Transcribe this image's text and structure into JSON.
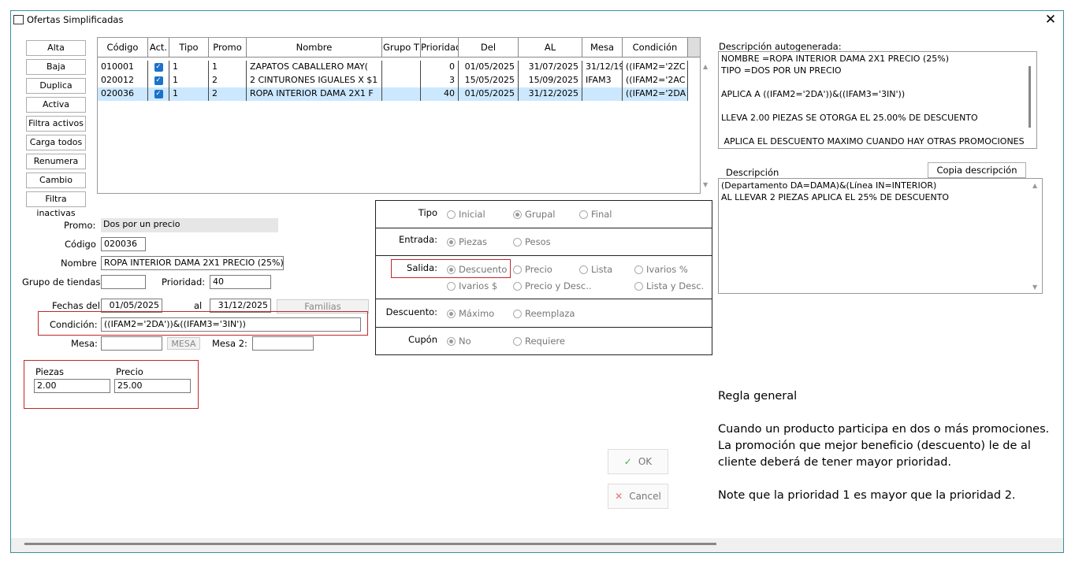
{
  "window": {
    "title": "Ofertas Simplificadas"
  },
  "buttons": [
    "Alta",
    "Baja",
    "Duplica",
    "Activa",
    "Filtra activos",
    "Carga todos",
    "Renumera",
    "Cambio",
    "Filtra inactivas"
  ],
  "grid": {
    "columns": [
      "Código",
      "Act.",
      "Tipo",
      "Promo",
      "Nombre",
      "Grupo T",
      "Prioridad",
      "Del",
      "AL",
      "Mesa",
      "Condición"
    ],
    "rows": [
      {
        "codigo": "010001",
        "tipo": "1",
        "promo": "1",
        "nombre": "ZAPATOS CABALLERO MAY(",
        "grupo": "",
        "prioridad": "0",
        "del": "01/05/2025",
        "al": "31/07/2025",
        "mesa": "31/12/19",
        "condicion": "((IFAM2='2ZC"
      },
      {
        "codigo": "020012",
        "tipo": "1",
        "promo": "2",
        "nombre": "2 CINTURONES IGUALES X $1",
        "grupo": "",
        "prioridad": "3",
        "del": "15/05/2025",
        "al": "15/09/2025",
        "mesa": "IFAM3",
        "condicion": "((IFAM2='2AC"
      },
      {
        "codigo": "020036",
        "tipo": "1",
        "promo": "2",
        "nombre": "ROPA INTERIOR DAMA 2X1 F",
        "grupo": "",
        "prioridad": "40",
        "del": "01/05/2025",
        "al": "31/12/2025",
        "mesa": "",
        "condicion": "((IFAM2='2DA"
      }
    ]
  },
  "form": {
    "promo_label": "Promo:",
    "promo_value": "Dos por un precio",
    "codigo_label": "Código",
    "codigo_value": "020036",
    "nombre_label": "Nombre",
    "nombre_value": "ROPA INTERIOR DAMA 2X1 PRECIO (25%)",
    "grupo_label": "Grupo de tiendas:",
    "grupo_value": "",
    "prioridad_label": "Prioridad:",
    "prioridad_value": "40",
    "fechas_label": "Fechas del",
    "fecha_del": "01/05/2025",
    "al_label": "al",
    "fecha_al": "31/12/2025",
    "familias_label": "Familias",
    "condicion_label": "Condición:",
    "condicion_value": "((IFAM2='2DA'))&((IFAM3='3IN'))",
    "mesa_label": "Mesa:",
    "mesa_value": "",
    "mesa_btn": "MESA",
    "mesa2_label": "Mesa 2:",
    "mesa2_value": "",
    "piezas_label": "Piezas",
    "piezas_value": "2.00",
    "precio_label": "Precio",
    "precio_value": "25.00"
  },
  "options": {
    "tipo_label": "Tipo",
    "tipo": [
      "Inicial",
      "Grupal",
      "Final"
    ],
    "entrada_label": "Entrada:",
    "entrada": [
      "Piezas",
      "Pesos"
    ],
    "salida_label": "Salida:",
    "salida": [
      "Descuento",
      "Precio",
      "Lista",
      "Ivarios %",
      "Ivarios $",
      "Precio y Desc..",
      "Lista y Desc."
    ],
    "descuento_label": "Descuento:",
    "descuento": [
      "Máximo",
      "Reemplaza"
    ],
    "cupon_label": "Cupón",
    "cupon": [
      "No",
      "Requiere"
    ]
  },
  "autodesc": {
    "label": "Descripción autogenerada:",
    "text": "NOMBRE =ROPA INTERIOR DAMA 2X1 PRECIO (25%)\nTIPO =DOS POR UN PRECIO\n\nAPLICA A ((IFAM2='2DA'))&((IFAM3='3IN'))\n\nLLEVA 2.00 PIEZAS SE OTORGA EL 25.00% DE DESCUENTO\n\n APLICA EL DESCUENTO MAXIMO CUANDO HAY OTRAS PROMOCIONES"
  },
  "desc": {
    "label": "Descripción",
    "copy_btn": "Copia descripción",
    "text": "(Departamento DA=DAMA)&(Línea IN=INTERIOR)\nAL LLEVAR 2 PIEZAS APLICA EL 25% DE DESCUENTO"
  },
  "actions": {
    "ok": "OK",
    "cancel": "Cancel"
  },
  "note": {
    "title": "Regla general",
    "line1": "Cuando un producto participa en dos o más  promociones.",
    "line2": "La promoción que mejor beneficio (descuento)  le de al",
    "line3": "cliente deberá de tener mayor prioridad.",
    "line4": "Note que la prioridad 1 es mayor que la prioridad 2."
  }
}
